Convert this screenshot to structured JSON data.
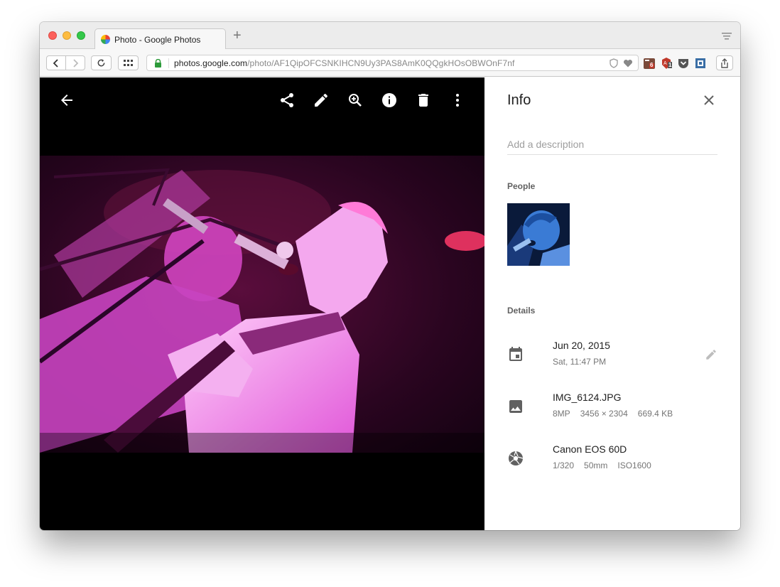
{
  "browser": {
    "tab_title": "Photo - Google Photos",
    "new_tab_symbol": "+",
    "url_host": "photos.google.com",
    "url_path": "/photo/AF1QipOFCSNKIHCN9Uy3PAS8AmK0QQgkHOsOBWOnF7nf",
    "extensions": [
      "todo-extension-icon",
      "adblock-extension-icon",
      "pocket-icon",
      "window-extension-icon"
    ],
    "ext_badges": [
      "6",
      "1"
    ]
  },
  "viewer": {
    "toolbar_icons": [
      "back-arrow-icon",
      "share-icon",
      "edit-icon",
      "zoom-in-icon",
      "info-icon",
      "delete-icon",
      "more-vert-icon"
    ]
  },
  "info": {
    "title": "Info",
    "description_placeholder": "Add a description",
    "people_label": "People",
    "details_label": "Details",
    "date": {
      "main": "Jun 20, 2015",
      "sub": "Sat, 11:47 PM"
    },
    "file": {
      "name": "IMG_6124.JPG",
      "megapixels": "8MP",
      "dimensions": "3456 × 2304",
      "size": "669.4 KB"
    },
    "camera": {
      "model": "Canon EOS 60D",
      "shutter": "1/320",
      "focal": "50mm",
      "iso": "ISO1600"
    }
  },
  "colors": {
    "photo_magenta": "#e03cd6",
    "face_blue": "#3a7bd5",
    "accent_green": "#2d9b3a"
  }
}
